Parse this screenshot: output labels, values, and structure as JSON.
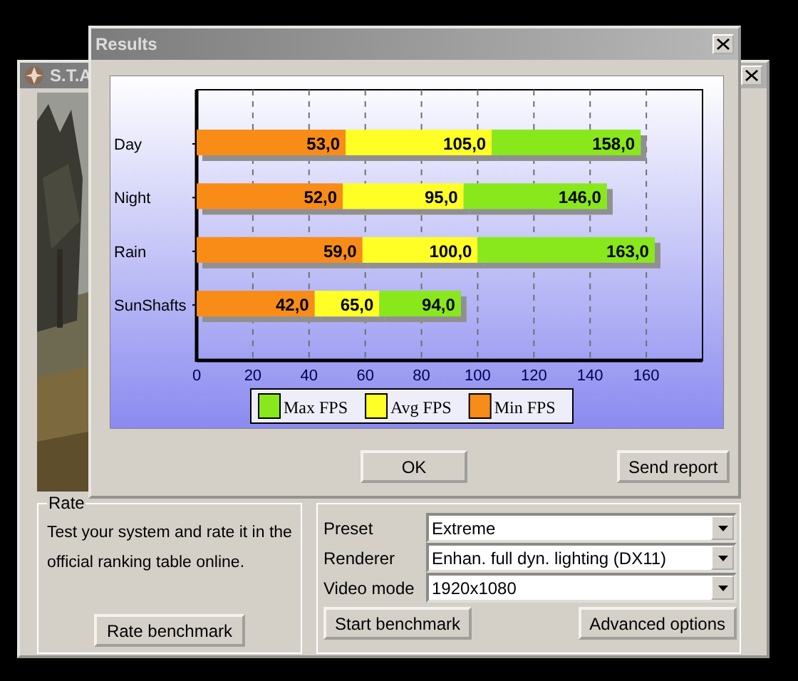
{
  "back_window": {
    "title": "S.T.A",
    "rate_group": {
      "caption": "Rate",
      "text": "Test your system and rate it in the official ranking table online.",
      "button": "Rate benchmark"
    },
    "main_group": {
      "fields": [
        {
          "label": "Preset",
          "value": "Extreme"
        },
        {
          "label": "Renderer",
          "value": "Enhan. full dyn. lighting (DX11)"
        },
        {
          "label": "Video mode",
          "value": "1920x1080"
        }
      ],
      "buttons": [
        "Start benchmark",
        "Advanced options"
      ]
    }
  },
  "results_window": {
    "title": "Results",
    "chart_data": {
      "type": "bar",
      "orientation": "horizontal",
      "stacked": true,
      "grid": true,
      "legend": true,
      "categories": [
        "Day",
        "Night",
        "Rain",
        "SunShafts"
      ],
      "series": [
        {
          "name": "Max FPS",
          "color": "#88e81c",
          "values": [
            53,
            51,
            63,
            29
          ]
        },
        {
          "name": "Avg FPS",
          "color": "#ffff28",
          "values": [
            52,
            43,
            41,
            23
          ]
        },
        {
          "name": "Min FPS",
          "color": "#f88c18",
          "values": [
            53,
            52,
            59,
            42
          ]
        }
      ],
      "value_labels": [
        [
          "158,0",
          "146,0",
          "163,0",
          "94,0"
        ],
        [
          "105,0",
          "95,0",
          "100,0",
          "65,0"
        ],
        [
          "53,0",
          "52,0",
          "59,0",
          "42,0"
        ]
      ],
      "xlim": [
        0,
        180
      ],
      "xticks": [
        0,
        20,
        40,
        60,
        80,
        100,
        120,
        140,
        160
      ]
    },
    "buttons": [
      "OK",
      "Send report"
    ]
  }
}
